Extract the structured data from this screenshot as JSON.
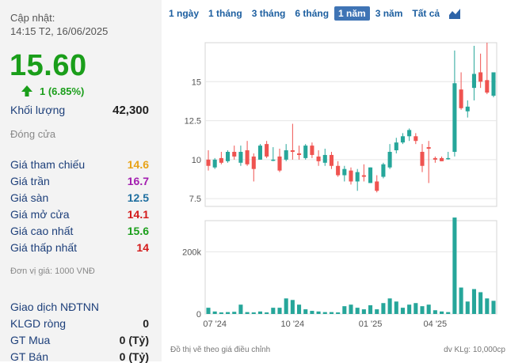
{
  "header": {
    "updated_label": "Cập nhật:",
    "updated_time": "14:15 T2, 16/06/2025"
  },
  "quote": {
    "price": "15.60",
    "change": "1 (6.85%)",
    "direction_color": "#1a9e1a"
  },
  "volume": {
    "label": "Khối lượng",
    "value": "42,300"
  },
  "status": "Đóng cửa",
  "stats": [
    {
      "label": "Giá tham chiếu",
      "value": "14.6",
      "color": "#e8a317"
    },
    {
      "label": "Giá trần",
      "value": "16.7",
      "color": "#a21caf"
    },
    {
      "label": "Giá sàn",
      "value": "12.5",
      "color": "#1f6fa0"
    },
    {
      "label": "Giá mở cửa",
      "value": "14.1",
      "color": "#d31a1a"
    },
    {
      "label": "Giá cao nhất",
      "value": "15.6",
      "color": "#1a9e1a"
    },
    {
      "label": "Giá thấp nhất",
      "value": "14",
      "color": "#d31a1a"
    }
  ],
  "unit_note": "Đơn vị giá: 1000 VNĐ",
  "foreign": {
    "title": "Giao dịch NĐTNN",
    "rows": [
      {
        "label": "KLGD ròng",
        "value": "0"
      },
      {
        "label": "GT Mua",
        "value": "0 (Tỷ)"
      },
      {
        "label": "GT Bán",
        "value": "0 (Tỷ)"
      }
    ]
  },
  "tabs": [
    {
      "label": "1 ngày",
      "active": false
    },
    {
      "label": "1 tháng",
      "active": false
    },
    {
      "label": "3 tháng",
      "active": false
    },
    {
      "label": "6 tháng",
      "active": false
    },
    {
      "label": "1 năm",
      "active": true
    },
    {
      "label": "3 năm",
      "active": false
    },
    {
      "label": "Tất cả",
      "active": false
    }
  ],
  "footer": {
    "left_note": "Đồ thị vẽ theo giá điều chỉnh",
    "right_note": "dv KLg: 10,000cp"
  },
  "chart_data": {
    "type": "candlestick",
    "x_tick_labels": [
      "07 '24",
      "10 '24",
      "01 '25",
      "04 '25"
    ],
    "x_tick_index": [
      1,
      13,
      25,
      35
    ],
    "price_axis": {
      "ticks": [
        "15",
        "12.5",
        "10",
        "7.5"
      ],
      "tick_values": [
        15,
        12.5,
        10,
        7.5
      ],
      "range": [
        7.0,
        17.5
      ]
    },
    "volume_axis": {
      "ticks": [
        "200k",
        "0"
      ],
      "tick_values": [
        200000,
        0
      ],
      "range": [
        0,
        300000
      ]
    },
    "colors": {
      "up": "#26a69a",
      "down": "#ef5350"
    },
    "candles": [
      {
        "o": 10.0,
        "h": 10.6,
        "l": 9.3,
        "c": 9.6,
        "v": 20000
      },
      {
        "o": 9.5,
        "h": 10.1,
        "l": 9.4,
        "c": 10.0,
        "v": 8000
      },
      {
        "o": 10.1,
        "h": 10.5,
        "l": 9.7,
        "c": 9.8,
        "v": 5000
      },
      {
        "o": 9.9,
        "h": 10.6,
        "l": 9.8,
        "c": 10.5,
        "v": 6000
      },
      {
        "o": 10.5,
        "h": 10.9,
        "l": 10.0,
        "c": 10.2,
        "v": 7000
      },
      {
        "o": 9.8,
        "h": 10.9,
        "l": 9.6,
        "c": 10.5,
        "v": 30000
      },
      {
        "o": 10.6,
        "h": 11.2,
        "l": 9.6,
        "c": 9.7,
        "v": 6000
      },
      {
        "o": 10.2,
        "h": 10.4,
        "l": 8.6,
        "c": 9.4,
        "v": 5000
      },
      {
        "o": 10.0,
        "h": 11.0,
        "l": 10.0,
        "c": 10.9,
        "v": 8000
      },
      {
        "o": 11.0,
        "h": 11.2,
        "l": 10.1,
        "c": 10.2,
        "v": 5000
      },
      {
        "o": 10.0,
        "h": 10.8,
        "l": 9.9,
        "c": 10.0,
        "v": 20000
      },
      {
        "o": 10.2,
        "h": 10.7,
        "l": 9.2,
        "c": 9.3,
        "v": 20000
      },
      {
        "o": 10.0,
        "h": 11.0,
        "l": 9.9,
        "c": 10.6,
        "v": 50000
      },
      {
        "o": 10.6,
        "h": 12.3,
        "l": 10.0,
        "c": 10.5,
        "v": 45000
      },
      {
        "o": 10.4,
        "h": 10.9,
        "l": 10.0,
        "c": 10.3,
        "v": 30000
      },
      {
        "o": 10.1,
        "h": 11.0,
        "l": 10.0,
        "c": 10.9,
        "v": 15000
      },
      {
        "o": 10.9,
        "h": 11.1,
        "l": 10.1,
        "c": 10.3,
        "v": 10000
      },
      {
        "o": 10.2,
        "h": 10.6,
        "l": 9.6,
        "c": 9.9,
        "v": 8000
      },
      {
        "o": 9.8,
        "h": 10.7,
        "l": 9.6,
        "c": 10.3,
        "v": 6000
      },
      {
        "o": 10.3,
        "h": 10.5,
        "l": 9.4,
        "c": 9.6,
        "v": 6000
      },
      {
        "o": 9.6,
        "h": 9.9,
        "l": 8.9,
        "c": 9.0,
        "v": 5000
      },
      {
        "o": 9.0,
        "h": 9.6,
        "l": 8.6,
        "c": 9.4,
        "v": 25000
      },
      {
        "o": 9.3,
        "h": 9.5,
        "l": 8.4,
        "c": 8.6,
        "v": 30000
      },
      {
        "o": 8.6,
        "h": 9.4,
        "l": 8.0,
        "c": 9.2,
        "v": 20000
      },
      {
        "o": 9.0,
        "h": 9.7,
        "l": 8.6,
        "c": 8.9,
        "v": 15000
      },
      {
        "o": 8.5,
        "h": 9.5,
        "l": 8.5,
        "c": 9.5,
        "v": 28000
      },
      {
        "o": 8.6,
        "h": 9.0,
        "l": 7.9,
        "c": 8.0,
        "v": 15000
      },
      {
        "o": 8.9,
        "h": 9.8,
        "l": 8.8,
        "c": 9.7,
        "v": 35000
      },
      {
        "o": 9.5,
        "h": 11.0,
        "l": 9.4,
        "c": 10.5,
        "v": 50000
      },
      {
        "o": 10.6,
        "h": 11.4,
        "l": 10.4,
        "c": 11.1,
        "v": 40000
      },
      {
        "o": 11.1,
        "h": 11.7,
        "l": 11.0,
        "c": 11.5,
        "v": 20000
      },
      {
        "o": 11.5,
        "h": 12.0,
        "l": 11.2,
        "c": 11.9,
        "v": 30000
      },
      {
        "o": 11.5,
        "h": 11.7,
        "l": 11.0,
        "c": 11.2,
        "v": 35000
      },
      {
        "o": 10.5,
        "h": 11.0,
        "l": 9.2,
        "c": 9.6,
        "v": 25000
      },
      {
        "o": 10.8,
        "h": 11.2,
        "l": 8.5,
        "c": 10.7,
        "v": 30000
      },
      {
        "o": 10.1,
        "h": 10.2,
        "l": 9.8,
        "c": 10.0,
        "v": 12000
      },
      {
        "o": 10.1,
        "h": 10.2,
        "l": 9.9,
        "c": 9.9,
        "v": 8000
      },
      {
        "o": 10.1,
        "h": 10.5,
        "l": 10.0,
        "c": 10.1,
        "v": 6000
      },
      {
        "o": 10.5,
        "h": 17.0,
        "l": 10.2,
        "c": 14.9,
        "v": 310000
      },
      {
        "o": 14.5,
        "h": 15.6,
        "l": 13.2,
        "c": 13.3,
        "v": 85000
      },
      {
        "o": 13.1,
        "h": 13.8,
        "l": 12.7,
        "c": 13.4,
        "v": 40000
      },
      {
        "o": 14.6,
        "h": 17.3,
        "l": 13.8,
        "c": 15.5,
        "v": 80000
      },
      {
        "o": 15.6,
        "h": 16.8,
        "l": 14.6,
        "c": 15.0,
        "v": 70000
      },
      {
        "o": 15.1,
        "h": 17.5,
        "l": 14.2,
        "c": 14.3,
        "v": 50000
      },
      {
        "o": 14.1,
        "h": 15.6,
        "l": 14.0,
        "c": 15.6,
        "v": 42300
      }
    ]
  }
}
